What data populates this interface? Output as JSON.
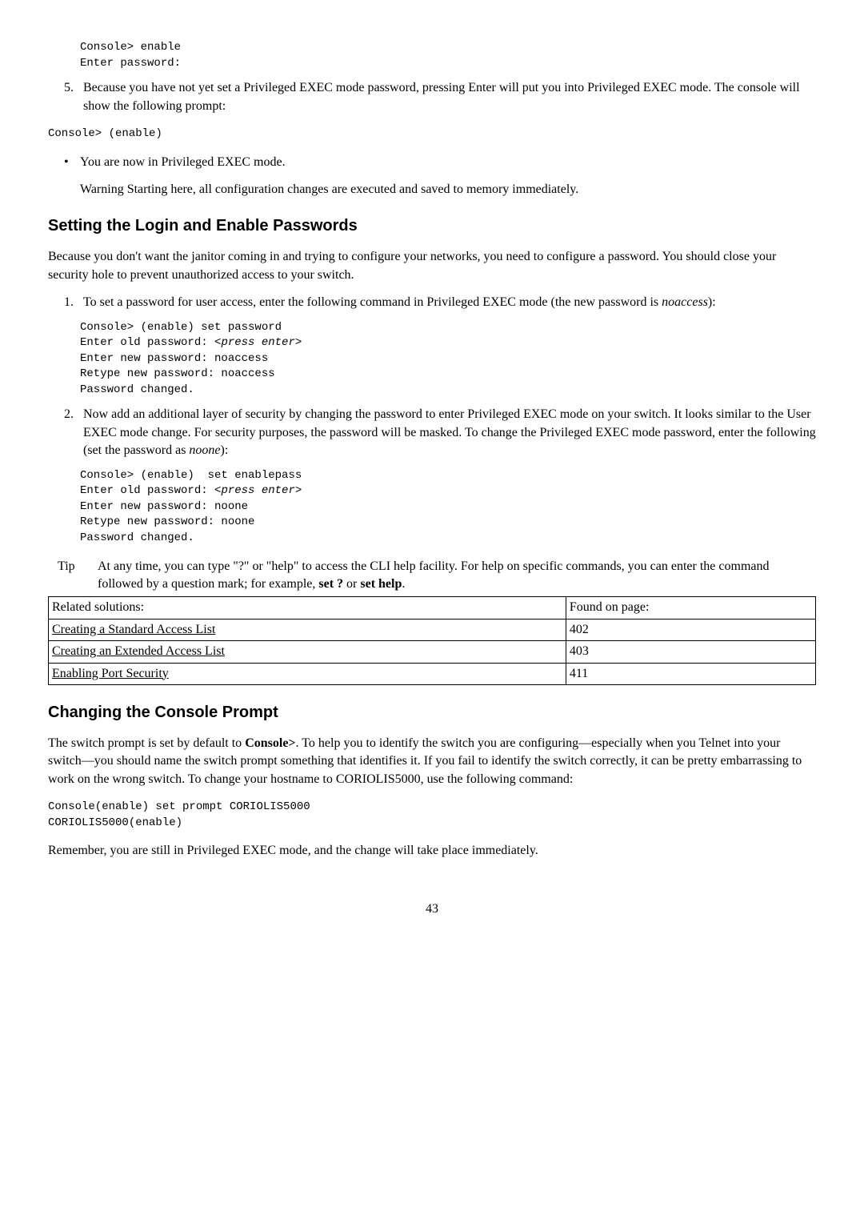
{
  "code1": "Console> enable\nEnter password:",
  "step5_num": "5.",
  "step5_text": "Because you have not yet set a Privileged EXEC mode password, pressing Enter will put you into Privileged EXEC mode. The console will show the following prompt:",
  "code2": "Console> (enable)",
  "bullet1": "You are now in Privileged EXEC mode.",
  "warning_label": "Warning ",
  "warning_text": "Starting here, all configuration changes are executed and saved to memory immediately.",
  "h1": "Setting the Login and Enable Passwords",
  "p1": "Because you don't want the janitor coming in and trying to configure your networks, you need to configure a password. You should close your security hole to prevent unauthorized access to your switch.",
  "step1_num": "1.",
  "step1_text_a": "To set a password for user access, enter the following command in Privileged EXEC mode (the new password is ",
  "step1_text_b": "noaccess",
  "step1_text_c": "):",
  "code3_a": "Console> (enable) set password\nEnter old password: <",
  "code3_b": "press enter",
  "code3_c": ">\nEnter new password: noaccess\nRetype new password: noaccess\nPassword changed.",
  "step2_num": "2.",
  "step2_text_a": "Now add an additional layer of security by changing the password to enter Privileged EXEC mode on your switch. It looks similar to the User EXEC mode change. For security purposes, the password will be masked. To change the Privileged EXEC mode password, enter the following (set the password as ",
  "step2_text_b": "noone",
  "step2_text_c": "):",
  "code4_a": "Console> (enable)  set enablepass\nEnter old password: <",
  "code4_b": "press enter",
  "code4_c": ">\nEnter new password: noone\nRetype new password: noone\nPassword changed.",
  "tip_label": "Tip",
  "tip_text_a": "At any time, you can type \"?\" or \"help\" to access the CLI help facility. For help on specific commands, you can enter the command followed by a question mark; for example, ",
  "tip_text_b": "set ?",
  "tip_text_c": " or ",
  "tip_text_d": "set help",
  "tip_text_e": ".",
  "table": {
    "h1": "Related solutions:",
    "h2": "Found on page:",
    "r1c1": "Creating a Standard Access List",
    "r1c2": "402",
    "r2c1": "Creating an Extended Access List",
    "r2c2": "403",
    "r3c1": "Enabling Port Security",
    "r3c2": "411"
  },
  "h2": "Changing the Console Prompt",
  "p2_a": "The switch prompt is set by default to ",
  "p2_b": "Console>",
  "p2_c": ". To help you to identify the switch you are configuring—especially when you Telnet into your switch—you should name the switch prompt something that identifies it. If you fail to identify the switch correctly, it can be pretty embarrassing to work on the wrong switch. To change your hostname to CORIOLIS5000, use the following command:",
  "code5": "Console(enable) set prompt CORIOLIS5000\nCORIOLIS5000(enable)",
  "p3": "Remember, you are still in Privileged EXEC mode, and the change will take place immediately.",
  "page_num": "43"
}
